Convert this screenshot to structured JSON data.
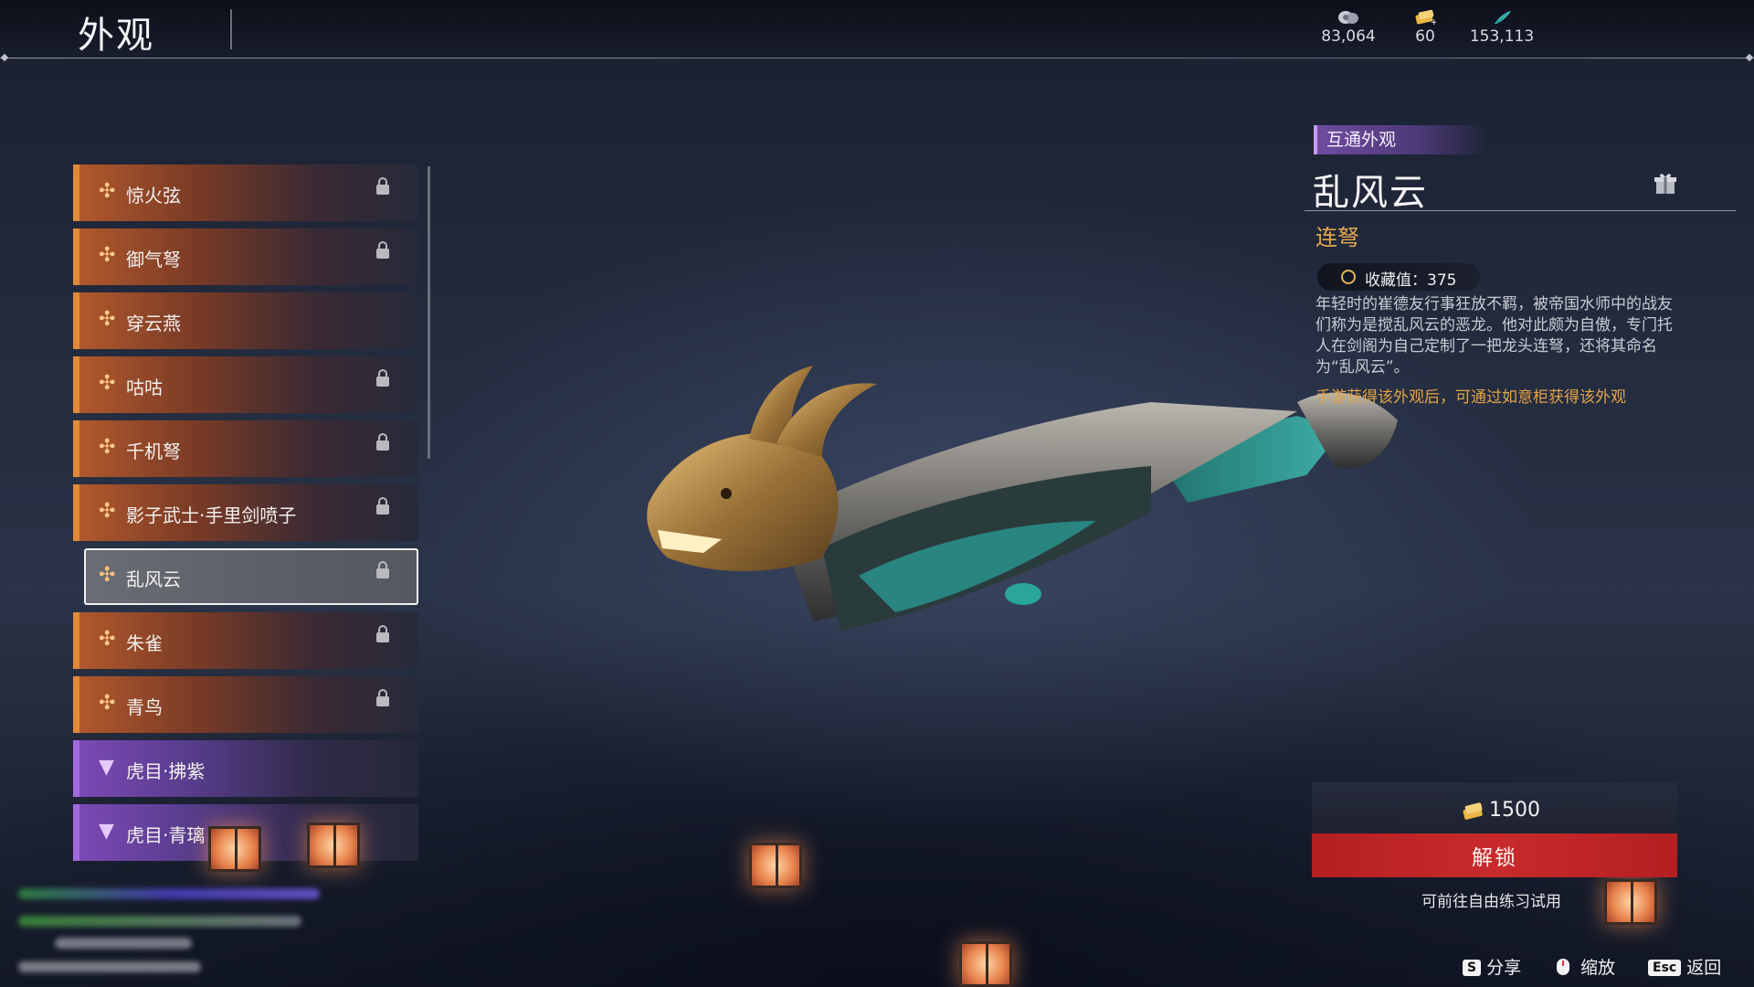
{
  "header": {
    "title": "外观"
  },
  "currencies": [
    {
      "icon": "silver-coin-icon",
      "value": "83,064"
    },
    {
      "icon": "gold-ticket-icon",
      "value": "60"
    },
    {
      "icon": "jade-feather-icon",
      "value": "153,113"
    }
  ],
  "list": {
    "items": [
      {
        "label": "惊火弦",
        "rarity": "orange",
        "locked": true
      },
      {
        "label": "御气弩",
        "rarity": "orange",
        "locked": true
      },
      {
        "label": "穿云燕",
        "rarity": "orange",
        "locked": false
      },
      {
        "label": "咕咕",
        "rarity": "orange",
        "locked": true
      },
      {
        "label": "千机弩",
        "rarity": "orange",
        "locked": true
      },
      {
        "label": "影子武士·手里剑喷子",
        "rarity": "orange",
        "locked": true
      },
      {
        "label": "乱风云",
        "rarity": "orange",
        "locked": true,
        "selected": true
      },
      {
        "label": "朱雀",
        "rarity": "orange",
        "locked": true
      },
      {
        "label": "青鸟",
        "rarity": "orange",
        "locked": true
      },
      {
        "label": "虎目·拂紫",
        "rarity": "purple",
        "locked": false
      },
      {
        "label": "虎目·青璃",
        "rarity": "purple",
        "locked": false
      }
    ]
  },
  "detail": {
    "tag": "互通外观",
    "name": "乱风云",
    "type": "连弩",
    "collection_label": "收藏值：375",
    "description": "年轻时的崔德友行事狂放不羁，被帝国水师中的战友们称为是搅乱风云的恶龙。他对此颇为自傲，专门托人在剑阁为自己定制了一把龙头连弩，还将其命名为“乱风云”。",
    "hint": "手游获得该外观后，可通过如意柜获得该外观"
  },
  "purchase": {
    "price": "1500",
    "unlock_label": "解锁",
    "trial_label": "可前往自由练习试用"
  },
  "footer": {
    "share": {
      "key": "S",
      "label": "分享"
    },
    "zoom": {
      "label": "缩放"
    },
    "back": {
      "key": "Esc",
      "label": "返回"
    }
  },
  "colors": {
    "orange_rarity": "#e08a3a",
    "purple_rarity": "#a06adf",
    "accent_gold": "#e6a84d",
    "unlock_red": "#c82a2c"
  }
}
